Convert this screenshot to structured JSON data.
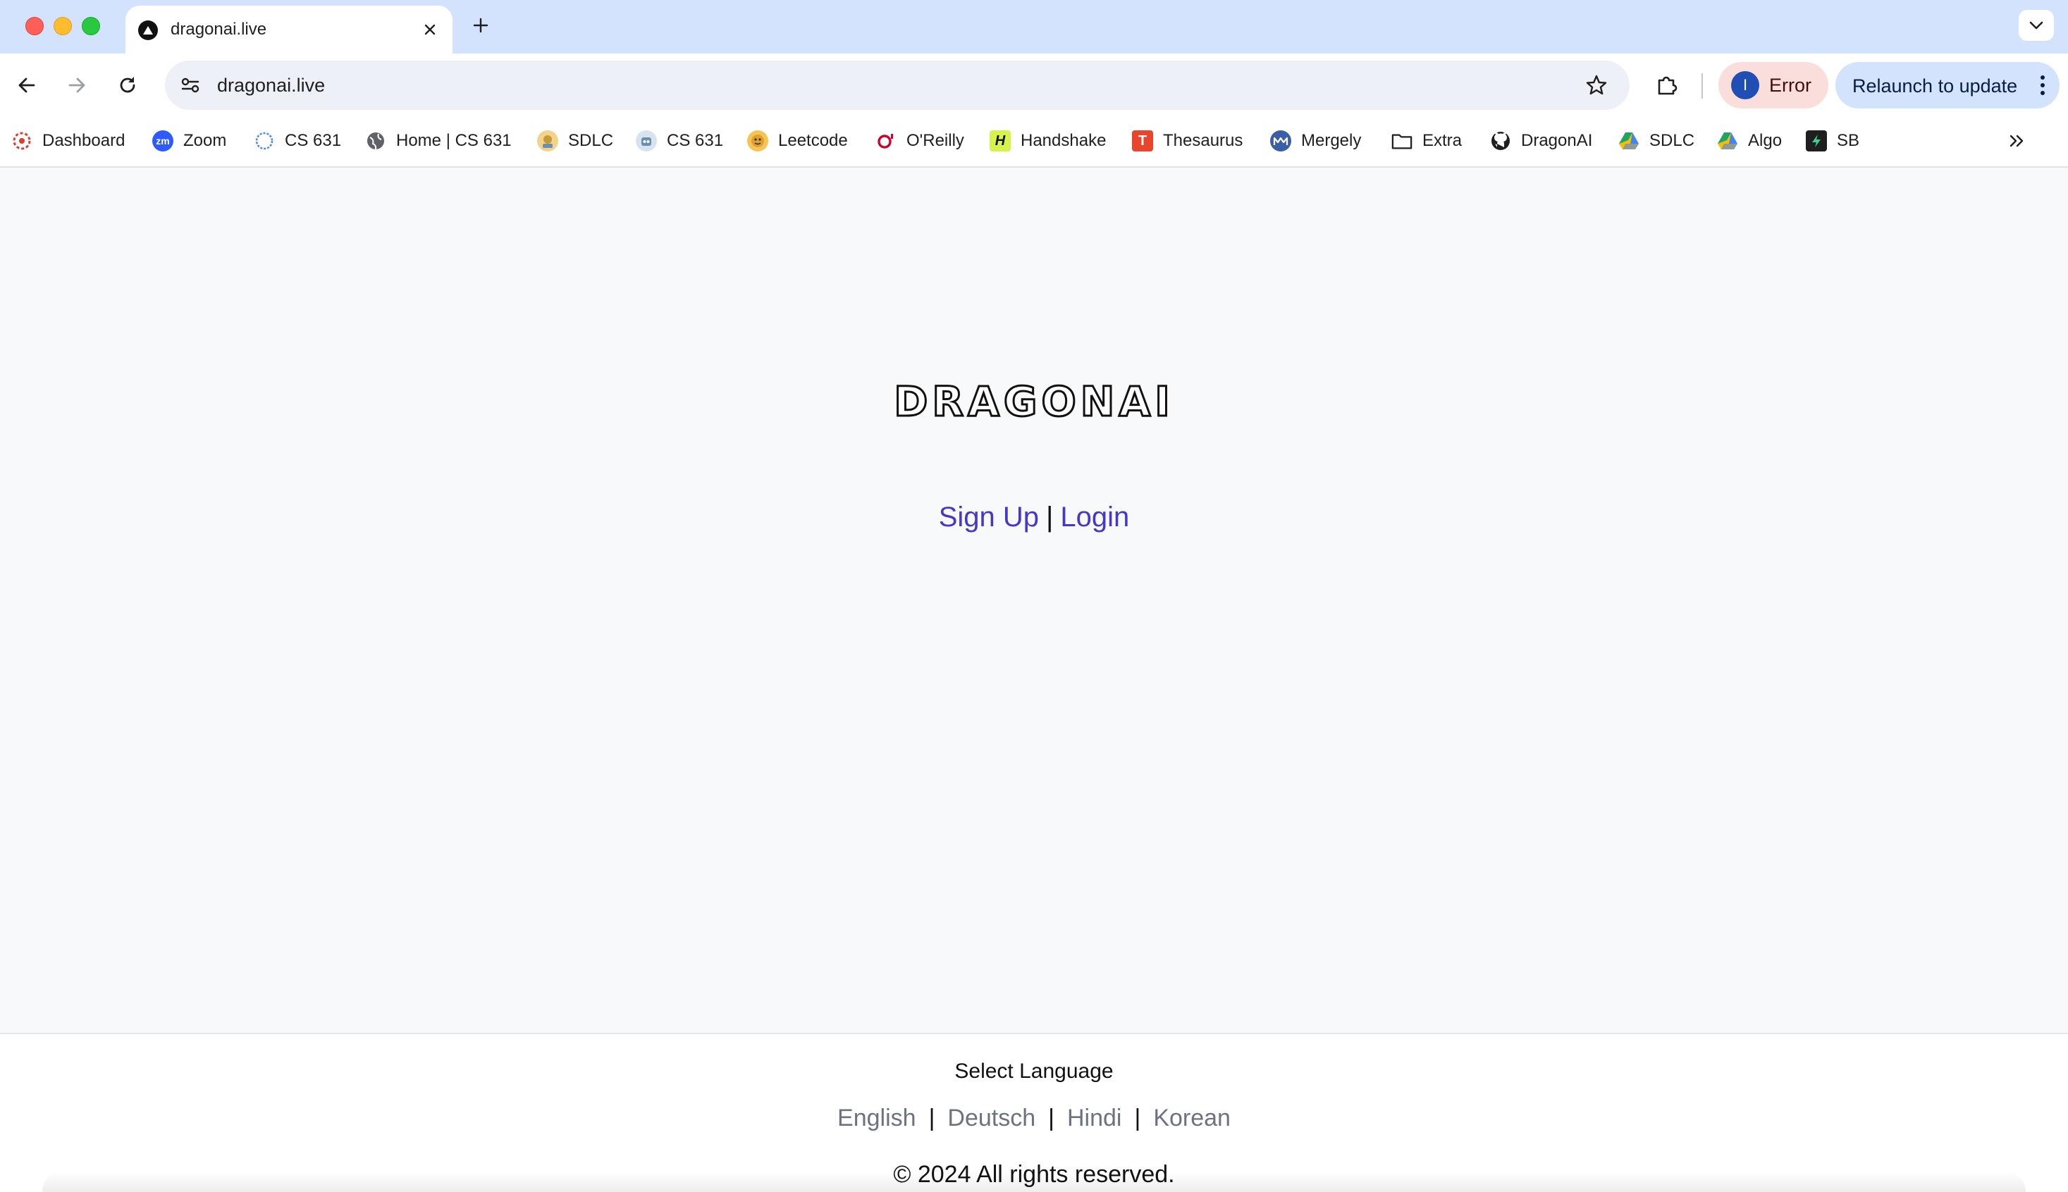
{
  "browser": {
    "tab": {
      "title": "dragonai.live"
    },
    "url": "dragonai.live",
    "profile_label": "Error",
    "profile_initial": "I",
    "relaunch_label": "Relaunch to update",
    "bookmarks": [
      {
        "label": "Dashboard",
        "icon": "canvas-icon",
        "color": "#e13c2d"
      },
      {
        "label": "Zoom",
        "icon": "zoom-icon",
        "color": "#2d5bff"
      },
      {
        "label": "CS 631",
        "icon": "ring-icon",
        "color": "#4c8bf5"
      },
      {
        "label": "Home | CS 631",
        "icon": "globe-icon",
        "color": "#5f6368"
      },
      {
        "label": "SDLC",
        "icon": "emoji-icon",
        "color": "#c49b3a"
      },
      {
        "label": "CS 631",
        "icon": "robot-icon",
        "color": "#6b8fb3"
      },
      {
        "label": "Leetcode",
        "icon": "emoji-icon",
        "color": "#e0a030"
      },
      {
        "label": "O'Reilly",
        "icon": "oreilly-icon",
        "color": "#d3002d"
      },
      {
        "label": "Handshake",
        "icon": "handshake-icon",
        "color": "#d6f24b"
      },
      {
        "label": "Thesaurus",
        "icon": "thesaurus-icon",
        "color": "#e8452c"
      },
      {
        "label": "Mergely",
        "icon": "mergely-icon",
        "color": "#3a5fa8"
      },
      {
        "label": "Extra",
        "icon": "folder-icon",
        "color": "#5f6368"
      },
      {
        "label": "DragonAI",
        "icon": "github-icon",
        "color": "#1f1f1f"
      },
      {
        "label": "SDLC",
        "icon": "drive-icon",
        "color": "#1fa463"
      },
      {
        "label": "Algo",
        "icon": "drive-icon",
        "color": "#1fa463"
      },
      {
        "label": "SB",
        "icon": "sb-icon",
        "color": "#1f1f1f"
      }
    ]
  },
  "page": {
    "logo": "DRAGONAI",
    "signup_label": "Sign Up",
    "auth_separator": "|",
    "login_label": "Login",
    "footer": {
      "title": "Select Language",
      "languages": [
        "English",
        "Deutsch",
        "Hindi",
        "Korean"
      ],
      "copyright": "© 2024 All rights reserved."
    }
  }
}
